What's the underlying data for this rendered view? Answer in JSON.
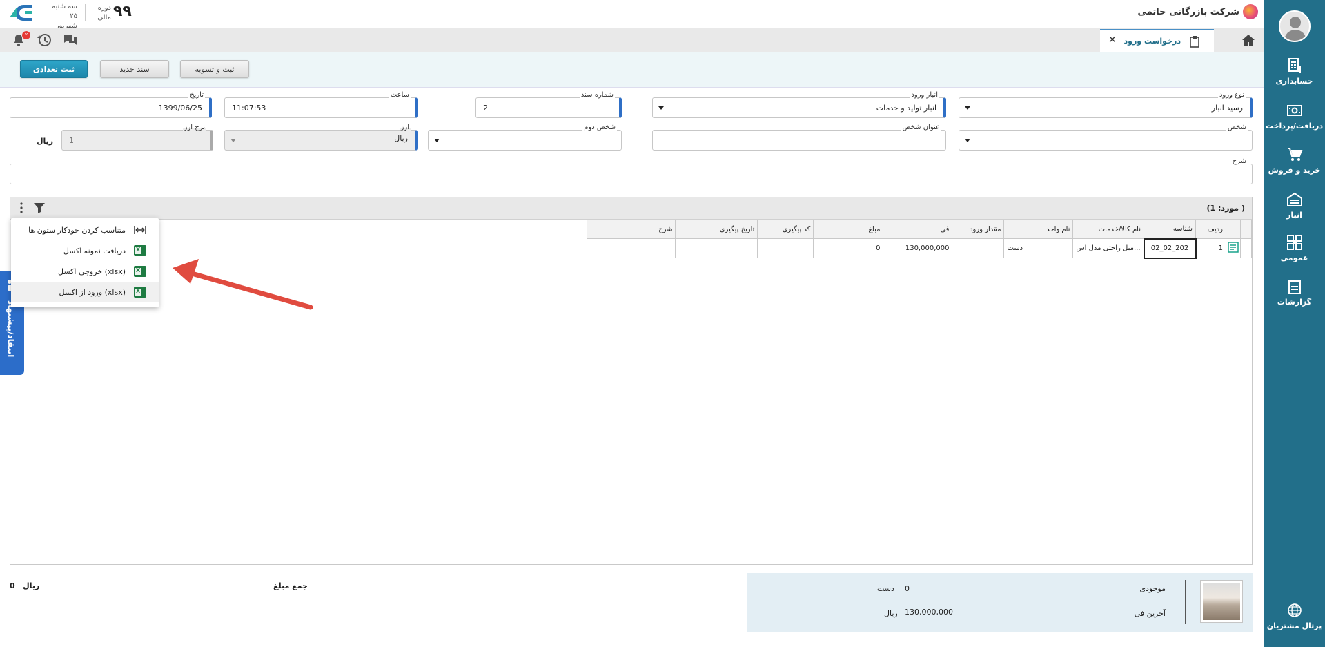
{
  "sidebar": {
    "items": [
      {
        "label": "حسابداری",
        "icon": "accounting-icon"
      },
      {
        "label": "دریافت/پرداخت",
        "icon": "cash-icon"
      },
      {
        "label": "خرید و فروش",
        "icon": "cart-icon"
      },
      {
        "label": "انبار",
        "icon": "warehouse-icon"
      },
      {
        "label": "عمومی",
        "icon": "general-icon"
      },
      {
        "label": "گزارشات",
        "icon": "reports-icon"
      }
    ],
    "portal_label": "پرتال مشتریان"
  },
  "header": {
    "company_name": "شرکت بازرگانی حاتمی",
    "fiscal_period_number": "۹۹",
    "fiscal_period_label_line1": "دوره",
    "fiscal_period_label_line2": "مالی",
    "date_line1": "سه شنبه ۲۵",
    "date_line2": "شهریور ۱۳۹۹",
    "notifications_count": "۲"
  },
  "tabs": {
    "active_label": "درخواست ورود",
    "close_glyph": "✕"
  },
  "toolbar": {
    "submit_count_label": "ثبت تعدادی",
    "new_doc_label": "سند جدید",
    "submit_settle_label": "ثبت و تسویه"
  },
  "form": {
    "entry_type": {
      "label": "نوع ورود",
      "value": "رسید انبار"
    },
    "entry_warehouse": {
      "label": "انبار ورود",
      "value": "انبار تولید و خدمات"
    },
    "doc_number": {
      "label": "شماره سند",
      "value": "2"
    },
    "time": {
      "label": "ساعت",
      "value": "11:07:53"
    },
    "date": {
      "label": "تاریخ",
      "value": "1399/06/25"
    },
    "person": {
      "label": "شخص",
      "value": ""
    },
    "person_title": {
      "label": "عنوان شخص",
      "value": ""
    },
    "second_person": {
      "label": "شخص دوم",
      "value": ""
    },
    "currency": {
      "label": "ارز",
      "value": "ریال"
    },
    "exchange_rate": {
      "label": "نرخ ارز",
      "value": "1"
    },
    "currency_unit": "ریال",
    "description": {
      "label": "شرح",
      "value": ""
    }
  },
  "grid": {
    "count_label": "(مورد:",
    "count_value": "1",
    "count_close": ")",
    "columns": [
      "ردیف",
      "شناسه",
      "نام کالا/خدمات",
      "نام واحد",
      "مقدار ورود",
      "فی",
      "مبلغ",
      "کد پیگیری",
      "تاریخ پیگیری",
      "شرح"
    ],
    "rows": [
      {
        "row": "1",
        "code": "02_02_202",
        "name": "مبل راحتی مدل اس...",
        "unit": "دست",
        "qty": "",
        "fee": "130,000,000",
        "amount": "0",
        "tracking_code": "",
        "tracking_date": "",
        "desc": ""
      }
    ]
  },
  "context_menu": {
    "items": [
      {
        "label": "متناسب کردن خودکار ستون ها",
        "icon": "fit-columns-icon"
      },
      {
        "label": "دریافت نمونه اکسل",
        "icon": "excel-icon"
      },
      {
        "label": "خروجی اکسل (xlsx)",
        "icon": "excel-icon"
      },
      {
        "label": "ورود از اکسل (xlsx)",
        "icon": "excel-icon"
      }
    ]
  },
  "feedback": {
    "label": "انتقاد/پیشنهاد"
  },
  "footer": {
    "total_label": "جمع مبلغ",
    "total_value": "0",
    "total_unit": "ریال",
    "stock_label": "موجودی",
    "stock_value": "0",
    "stock_unit": "دست",
    "last_fee_label": "آخرین فی",
    "last_fee_value": "130,000,000",
    "last_fee_unit": "ریال"
  },
  "colors": {
    "sidebar": "#226f8a",
    "primary_button": "#1d86aa",
    "required_marker": "#2f6fc6",
    "annotation_arrow": "#e04b3f",
    "feedback_tab": "#2c6dc9"
  }
}
